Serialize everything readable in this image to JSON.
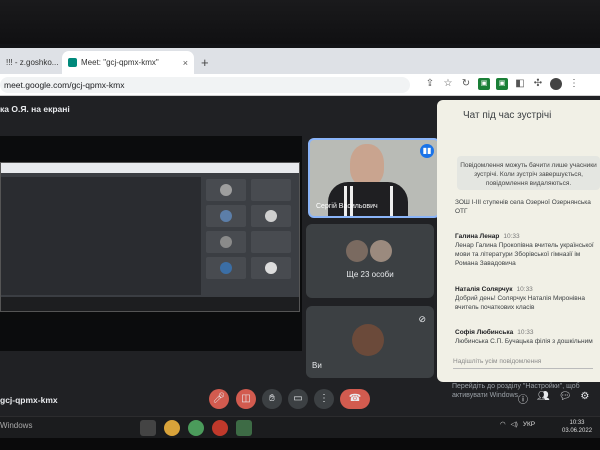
{
  "browser": {
    "tabs": [
      {
        "label": "!!! - z.goshko...",
        "active": false
      },
      {
        "label": "Meet: \"gcj-qpmx-kmx\"",
        "active": true
      }
    ],
    "new_tab": "+",
    "tab_close": "×",
    "url": "meet.google.com/gcj-qpmx-kmx",
    "toolbar_icons": [
      "share-icon",
      "star-icon",
      "reload-icon",
      "extension-icon",
      "extension-icon",
      "extension-icon",
      "puzzle-icon",
      "avatar-icon",
      "menu-icon"
    ]
  },
  "meet": {
    "presenting_label": "ка О.Я. на екрані",
    "main_speaker_caption": "Сергій Васильович",
    "more_participants": "Ще 23 особи",
    "self_label": "Ви",
    "meeting_code": "gcj-qpmx-kmx",
    "activation_text": [
      "Перейдіть до розділу \"Настройки\", щоб",
      "активувати Windows."
    ]
  },
  "chat": {
    "title": "Чат під час зустрічі",
    "notice": "Повідомлення можуть бачити лише учасники зустрічі. Коли зустріч завершується, повідомлення видаляються.",
    "messages": [
      {
        "author": "",
        "time": "",
        "text": "ЗОШ І-ІІІ ступенів села Озерної Озернянська ОТГ"
      },
      {
        "author": "Галина Ленар",
        "time": "10:33",
        "text": "Ленар Галина Прокопівна вчитель української мови та літератури Зборівської гімназії ім Романа Завадовича"
      },
      {
        "author": "Наталія Солярчук",
        "time": "10:33",
        "text": "Добрий день! Солярчук Наталія Миронівна вчитель початкових класів"
      },
      {
        "author": "Софія Любинська",
        "time": "10:33",
        "text": "Любинська С.П. Бучацька філія з дошкільним"
      }
    ],
    "input_placeholder": "Надішліть усім повідомлення"
  },
  "taskbar": {
    "search": "Windows",
    "language": "УКР",
    "time": "10:33",
    "date": "03.06.2022"
  },
  "colors": {
    "meet_bg": "#202124",
    "chat_bg": "#f1f0e6",
    "end_call": "#d25b4f",
    "accent": "#1a73e8"
  }
}
